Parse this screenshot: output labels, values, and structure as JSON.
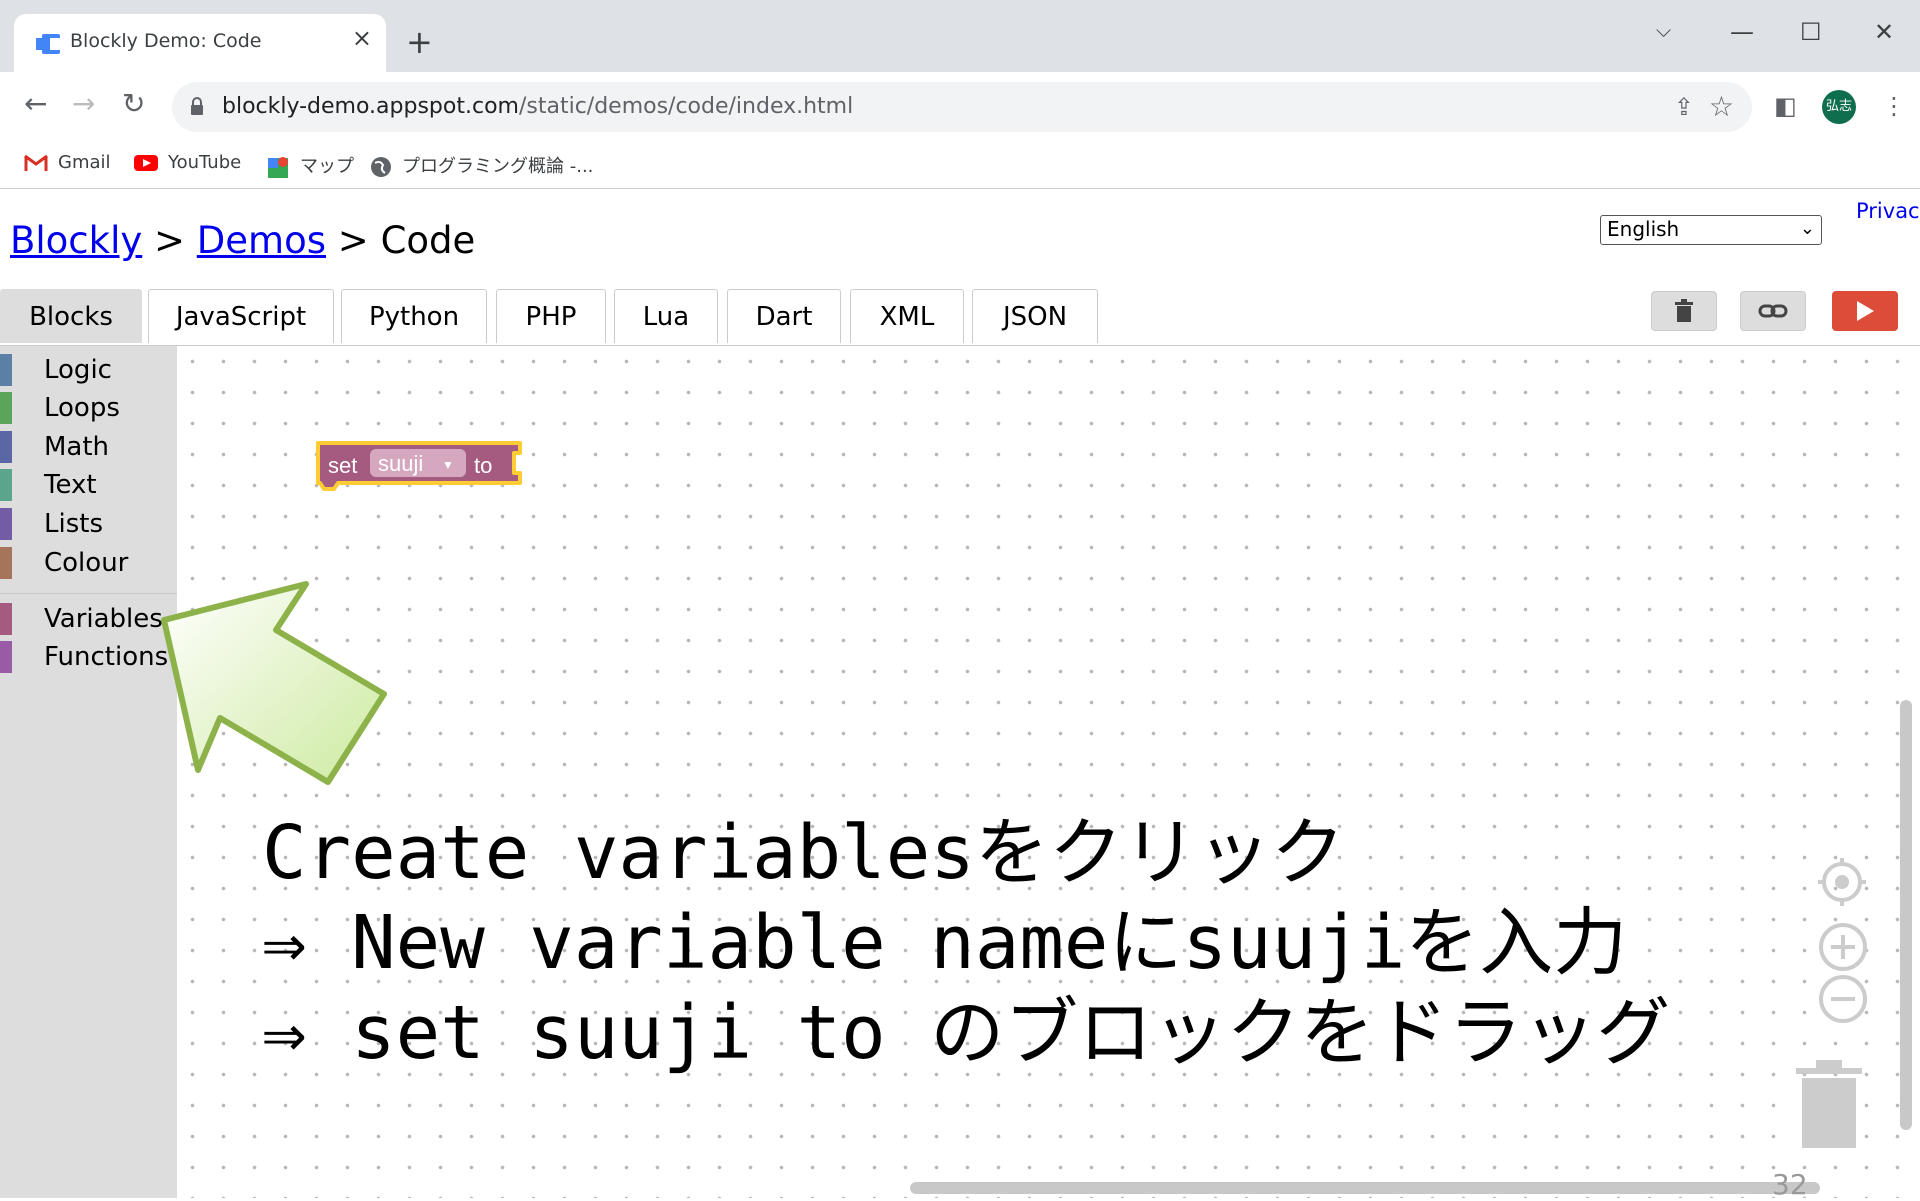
{
  "browser": {
    "tab_title": "Blockly Demo: Code",
    "tab_close_icon": "close-icon",
    "new_tab_symbol": "+",
    "url_host": "blockly-demo.appspot.com",
    "url_path": "/static/demos/code/index.html",
    "avatar_text": "弘志",
    "bookmarks": [
      {
        "label": "Gmail",
        "icon": "gmail-icon"
      },
      {
        "label": "YouTube",
        "icon": "youtube-icon"
      },
      {
        "label": "マップ",
        "icon": "maps-icon"
      },
      {
        "label": "プログラミング概論 -...",
        "icon": "globe-icon"
      }
    ]
  },
  "page": {
    "breadcrumb": {
      "root": "Blockly",
      "sep1": ">",
      "demos": "Demos",
      "sep2": ">",
      "current": "Code"
    },
    "language_select": {
      "value": "English"
    },
    "privacy_link": "Privacy",
    "tabs": [
      {
        "label": "Blocks",
        "selected": true
      },
      {
        "label": "JavaScript"
      },
      {
        "label": "Python"
      },
      {
        "label": "PHP"
      },
      {
        "label": "Lua"
      },
      {
        "label": "Dart"
      },
      {
        "label": "XML"
      },
      {
        "label": "JSON"
      }
    ],
    "actions": {
      "trash_icon": "trash-icon",
      "link_icon": "link-icon",
      "run_icon": "play-icon"
    }
  },
  "toolbox": {
    "categories": [
      {
        "label": "Logic",
        "color": "#5b80a5"
      },
      {
        "label": "Loops",
        "color": "#5ba55b"
      },
      {
        "label": "Math",
        "color": "#5b67a5"
      },
      {
        "label": "Text",
        "color": "#5ba58c"
      },
      {
        "label": "Lists",
        "color": "#745ba5"
      },
      {
        "label": "Colour",
        "color": "#a5745b"
      },
      {
        "label": "Variables",
        "color": "#a55b80"
      },
      {
        "label": "Functions",
        "color": "#995ba5"
      }
    ]
  },
  "workspace": {
    "block": {
      "set_label": "set",
      "variable": "suuji",
      "to_label": "to",
      "color": "#a55b80",
      "highlight": "#fc3"
    },
    "annotation": [
      "Create variablesをクリック",
      "⇒ New variable nameにsuujiを入力",
      "⇒ set suuji to のブロックをドラッグ"
    ],
    "page_number": "32"
  }
}
